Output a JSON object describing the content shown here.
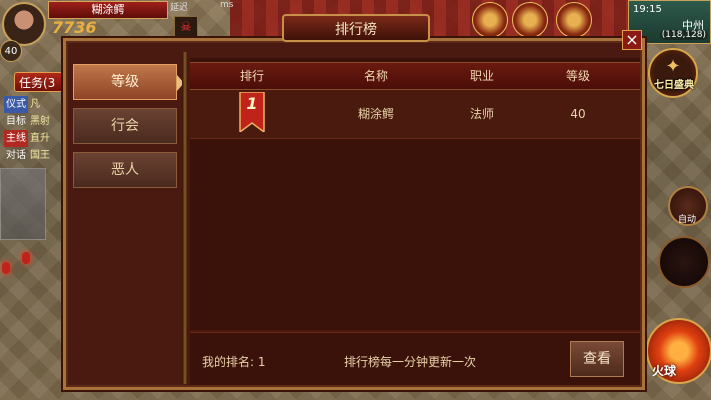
{
  "player": {
    "name": "糊涂鳄",
    "level": "40",
    "hp_fragment": "7736",
    "top_hint": "延迟",
    "ping_unit": "ms"
  },
  "quest": {
    "tab_label": "任务(3",
    "rows": [
      {
        "key": "仪式",
        "value": "凡",
        "style": "blue"
      },
      {
        "key": "目标",
        "value": "黑射",
        "style": "plain"
      },
      {
        "key": "主线",
        "value": "直升",
        "style": "red"
      },
      {
        "key": "对话",
        "value": "国王",
        "style": "plain"
      }
    ]
  },
  "map": {
    "time": "19:15",
    "name": "中州",
    "coords": "(118,128)"
  },
  "right_hud": {
    "seven_day_label": "七日盛典",
    "auto_label": "自动",
    "fire_label": "火球"
  },
  "dialog": {
    "title": "排行榜",
    "close_glyph": "×",
    "tabs": [
      {
        "label": "等级",
        "active": true
      },
      {
        "label": "行会",
        "active": false
      },
      {
        "label": "恶人",
        "active": false
      }
    ],
    "columns": [
      "排行",
      "名称",
      "职业",
      "等级"
    ],
    "rows": [
      {
        "rank": "1",
        "name": "糊涂鳄",
        "class": "法师",
        "level": "40"
      }
    ],
    "my_rank": "我的排名: 1",
    "update_note": "排行榜每一分钟更新一次",
    "check_label": "查看"
  },
  "colors": {
    "ribbon": "#c0231a",
    "frame_gold": "#a8733a",
    "panel_bg": "#4a1a10"
  }
}
